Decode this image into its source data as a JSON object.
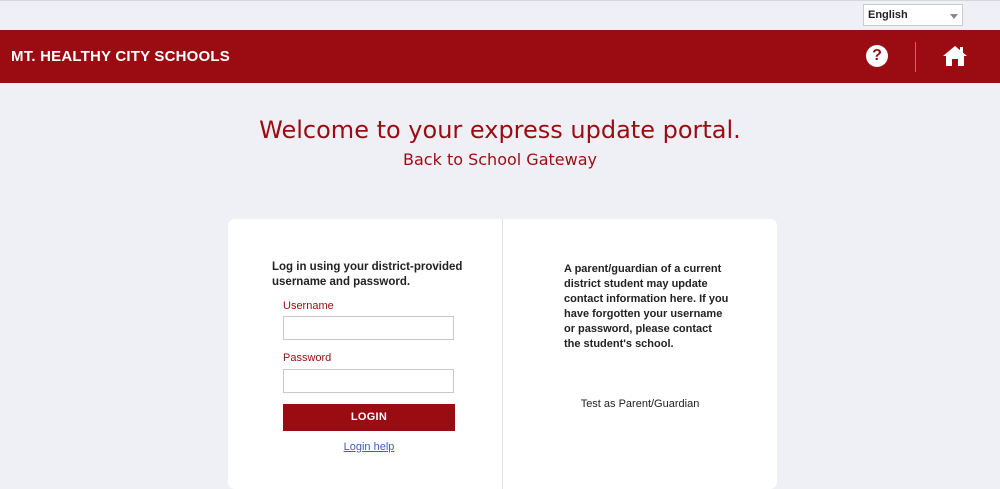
{
  "language": {
    "selected": "English"
  },
  "header": {
    "title": "MT. HEALTHY CITY SCHOOLS",
    "help_glyph": "?",
    "accent_color": "#9b0c12"
  },
  "hero": {
    "welcome": "Welcome to your express update portal.",
    "subtitle": "Back to School Gateway"
  },
  "login": {
    "intro": "Log in using your district-provided username and password.",
    "username_label": "Username",
    "username_value": "",
    "password_label": "Password",
    "password_value": "",
    "button_label": "LOGIN",
    "help_link": "Login help"
  },
  "parent": {
    "info": "A parent/guardian of a current district student may update contact information here. If you have forgotten your username or password, please contact the student's school.",
    "test_link": "Test as Parent/Guardian"
  }
}
